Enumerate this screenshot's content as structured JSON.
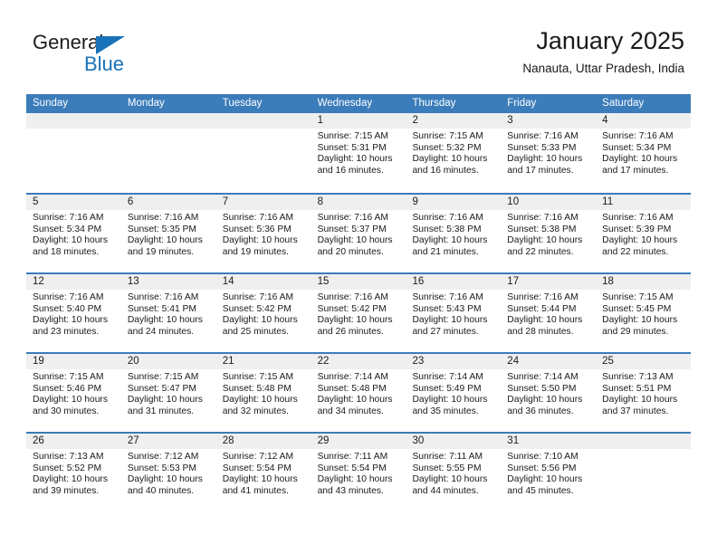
{
  "brand": {
    "name_dark": "General",
    "name_blue": "Blue",
    "accent_color": "#1a72b8"
  },
  "header": {
    "month_title": "January 2025",
    "location": "Nanauta, Uttar Pradesh, India"
  },
  "theme": {
    "header_row_bg": "#3b7cba",
    "daynum_band_bg": "#efefef",
    "row_divider": "#3b7cba",
    "text_color": "#1a1a1a"
  },
  "calendar": {
    "day_headers": [
      "Sunday",
      "Monday",
      "Tuesday",
      "Wednesday",
      "Thursday",
      "Friday",
      "Saturday"
    ],
    "weeks": [
      [
        {
          "day": "",
          "sunrise": "",
          "sunset": "",
          "daylight1": "",
          "daylight2": ""
        },
        {
          "day": "",
          "sunrise": "",
          "sunset": "",
          "daylight1": "",
          "daylight2": ""
        },
        {
          "day": "",
          "sunrise": "",
          "sunset": "",
          "daylight1": "",
          "daylight2": ""
        },
        {
          "day": "1",
          "sunrise": "Sunrise: 7:15 AM",
          "sunset": "Sunset: 5:31 PM",
          "daylight1": "Daylight: 10 hours",
          "daylight2": "and 16 minutes."
        },
        {
          "day": "2",
          "sunrise": "Sunrise: 7:15 AM",
          "sunset": "Sunset: 5:32 PM",
          "daylight1": "Daylight: 10 hours",
          "daylight2": "and 16 minutes."
        },
        {
          "day": "3",
          "sunrise": "Sunrise: 7:16 AM",
          "sunset": "Sunset: 5:33 PM",
          "daylight1": "Daylight: 10 hours",
          "daylight2": "and 17 minutes."
        },
        {
          "day": "4",
          "sunrise": "Sunrise: 7:16 AM",
          "sunset": "Sunset: 5:34 PM",
          "daylight1": "Daylight: 10 hours",
          "daylight2": "and 17 minutes."
        }
      ],
      [
        {
          "day": "5",
          "sunrise": "Sunrise: 7:16 AM",
          "sunset": "Sunset: 5:34 PM",
          "daylight1": "Daylight: 10 hours",
          "daylight2": "and 18 minutes."
        },
        {
          "day": "6",
          "sunrise": "Sunrise: 7:16 AM",
          "sunset": "Sunset: 5:35 PM",
          "daylight1": "Daylight: 10 hours",
          "daylight2": "and 19 minutes."
        },
        {
          "day": "7",
          "sunrise": "Sunrise: 7:16 AM",
          "sunset": "Sunset: 5:36 PM",
          "daylight1": "Daylight: 10 hours",
          "daylight2": "and 19 minutes."
        },
        {
          "day": "8",
          "sunrise": "Sunrise: 7:16 AM",
          "sunset": "Sunset: 5:37 PM",
          "daylight1": "Daylight: 10 hours",
          "daylight2": "and 20 minutes."
        },
        {
          "day": "9",
          "sunrise": "Sunrise: 7:16 AM",
          "sunset": "Sunset: 5:38 PM",
          "daylight1": "Daylight: 10 hours",
          "daylight2": "and 21 minutes."
        },
        {
          "day": "10",
          "sunrise": "Sunrise: 7:16 AM",
          "sunset": "Sunset: 5:38 PM",
          "daylight1": "Daylight: 10 hours",
          "daylight2": "and 22 minutes."
        },
        {
          "day": "11",
          "sunrise": "Sunrise: 7:16 AM",
          "sunset": "Sunset: 5:39 PM",
          "daylight1": "Daylight: 10 hours",
          "daylight2": "and 22 minutes."
        }
      ],
      [
        {
          "day": "12",
          "sunrise": "Sunrise: 7:16 AM",
          "sunset": "Sunset: 5:40 PM",
          "daylight1": "Daylight: 10 hours",
          "daylight2": "and 23 minutes."
        },
        {
          "day": "13",
          "sunrise": "Sunrise: 7:16 AM",
          "sunset": "Sunset: 5:41 PM",
          "daylight1": "Daylight: 10 hours",
          "daylight2": "and 24 minutes."
        },
        {
          "day": "14",
          "sunrise": "Sunrise: 7:16 AM",
          "sunset": "Sunset: 5:42 PM",
          "daylight1": "Daylight: 10 hours",
          "daylight2": "and 25 minutes."
        },
        {
          "day": "15",
          "sunrise": "Sunrise: 7:16 AM",
          "sunset": "Sunset: 5:42 PM",
          "daylight1": "Daylight: 10 hours",
          "daylight2": "and 26 minutes."
        },
        {
          "day": "16",
          "sunrise": "Sunrise: 7:16 AM",
          "sunset": "Sunset: 5:43 PM",
          "daylight1": "Daylight: 10 hours",
          "daylight2": "and 27 minutes."
        },
        {
          "day": "17",
          "sunrise": "Sunrise: 7:16 AM",
          "sunset": "Sunset: 5:44 PM",
          "daylight1": "Daylight: 10 hours",
          "daylight2": "and 28 minutes."
        },
        {
          "day": "18",
          "sunrise": "Sunrise: 7:15 AM",
          "sunset": "Sunset: 5:45 PM",
          "daylight1": "Daylight: 10 hours",
          "daylight2": "and 29 minutes."
        }
      ],
      [
        {
          "day": "19",
          "sunrise": "Sunrise: 7:15 AM",
          "sunset": "Sunset: 5:46 PM",
          "daylight1": "Daylight: 10 hours",
          "daylight2": "and 30 minutes."
        },
        {
          "day": "20",
          "sunrise": "Sunrise: 7:15 AM",
          "sunset": "Sunset: 5:47 PM",
          "daylight1": "Daylight: 10 hours",
          "daylight2": "and 31 minutes."
        },
        {
          "day": "21",
          "sunrise": "Sunrise: 7:15 AM",
          "sunset": "Sunset: 5:48 PM",
          "daylight1": "Daylight: 10 hours",
          "daylight2": "and 32 minutes."
        },
        {
          "day": "22",
          "sunrise": "Sunrise: 7:14 AM",
          "sunset": "Sunset: 5:48 PM",
          "daylight1": "Daylight: 10 hours",
          "daylight2": "and 34 minutes."
        },
        {
          "day": "23",
          "sunrise": "Sunrise: 7:14 AM",
          "sunset": "Sunset: 5:49 PM",
          "daylight1": "Daylight: 10 hours",
          "daylight2": "and 35 minutes."
        },
        {
          "day": "24",
          "sunrise": "Sunrise: 7:14 AM",
          "sunset": "Sunset: 5:50 PM",
          "daylight1": "Daylight: 10 hours",
          "daylight2": "and 36 minutes."
        },
        {
          "day": "25",
          "sunrise": "Sunrise: 7:13 AM",
          "sunset": "Sunset: 5:51 PM",
          "daylight1": "Daylight: 10 hours",
          "daylight2": "and 37 minutes."
        }
      ],
      [
        {
          "day": "26",
          "sunrise": "Sunrise: 7:13 AM",
          "sunset": "Sunset: 5:52 PM",
          "daylight1": "Daylight: 10 hours",
          "daylight2": "and 39 minutes."
        },
        {
          "day": "27",
          "sunrise": "Sunrise: 7:12 AM",
          "sunset": "Sunset: 5:53 PM",
          "daylight1": "Daylight: 10 hours",
          "daylight2": "and 40 minutes."
        },
        {
          "day": "28",
          "sunrise": "Sunrise: 7:12 AM",
          "sunset": "Sunset: 5:54 PM",
          "daylight1": "Daylight: 10 hours",
          "daylight2": "and 41 minutes."
        },
        {
          "day": "29",
          "sunrise": "Sunrise: 7:11 AM",
          "sunset": "Sunset: 5:54 PM",
          "daylight1": "Daylight: 10 hours",
          "daylight2": "and 43 minutes."
        },
        {
          "day": "30",
          "sunrise": "Sunrise: 7:11 AM",
          "sunset": "Sunset: 5:55 PM",
          "daylight1": "Daylight: 10 hours",
          "daylight2": "and 44 minutes."
        },
        {
          "day": "31",
          "sunrise": "Sunrise: 7:10 AM",
          "sunset": "Sunset: 5:56 PM",
          "daylight1": "Daylight: 10 hours",
          "daylight2": "and 45 minutes."
        },
        {
          "day": "",
          "sunrise": "",
          "sunset": "",
          "daylight1": "",
          "daylight2": ""
        }
      ]
    ]
  }
}
